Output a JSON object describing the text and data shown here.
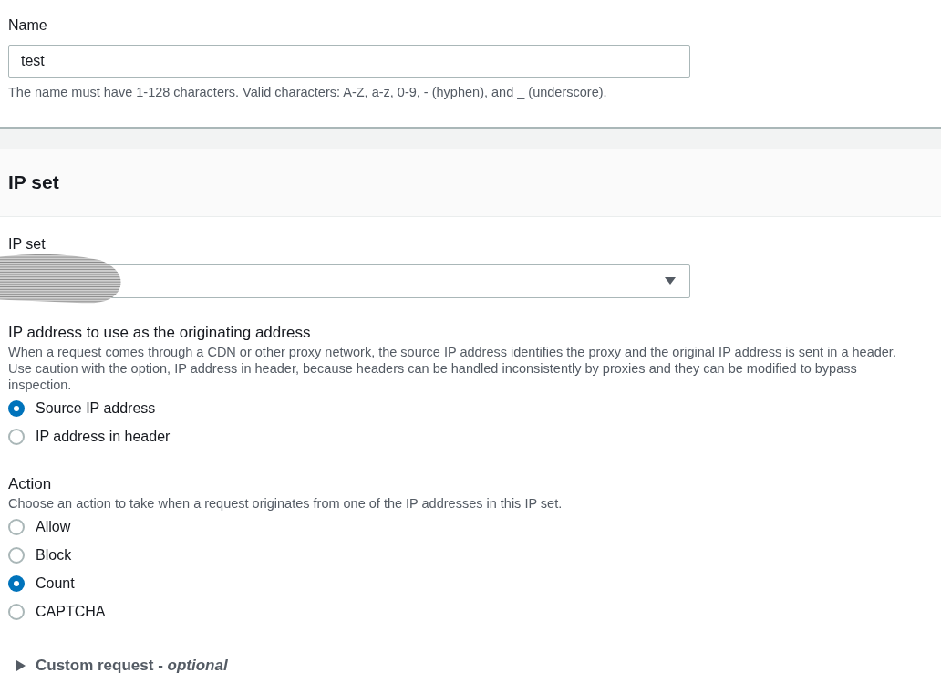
{
  "name_field": {
    "label": "Name",
    "value": "test",
    "hint": "The name must have 1-128 characters. Valid characters: A-Z, a-z, 0-9, - (hyphen), and _ (underscore)."
  },
  "section": {
    "title": "IP set"
  },
  "ip_set": {
    "label": "IP set",
    "redacted": true
  },
  "origin": {
    "label": "IP address to use as the originating address",
    "description": "When a request comes through a CDN or other proxy network, the source IP address identifies the proxy and the original IP address is sent in a header. Use caution with the option, IP address in header, because headers can be handled inconsistently by proxies and they can be modified to bypass inspection.",
    "options": [
      {
        "label": "Source IP address",
        "selected": true
      },
      {
        "label": "IP address in header",
        "selected": false
      }
    ]
  },
  "action": {
    "label": "Action",
    "description": "Choose an action to take when a request originates from one of the IP addresses in this IP set.",
    "options": [
      {
        "label": "Allow",
        "selected": false
      },
      {
        "label": "Block",
        "selected": false
      },
      {
        "label": "Count",
        "selected": true
      },
      {
        "label": "CAPTCHA",
        "selected": false
      }
    ]
  },
  "custom_request": {
    "label": "Custom request - *optional*",
    "expanded": false
  }
}
